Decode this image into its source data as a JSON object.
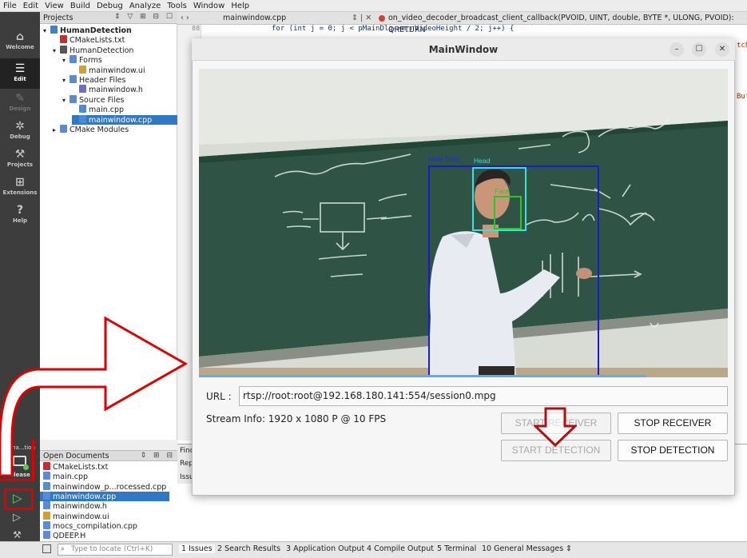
{
  "menu": [
    "File",
    "Edit",
    "View",
    "Build",
    "Debug",
    "Analyze",
    "Tools",
    "Window",
    "Help"
  ],
  "modes": [
    {
      "label": "Welcome",
      "icon": "⌂"
    },
    {
      "label": "Edit",
      "icon": "☰"
    },
    {
      "label": "Design",
      "icon": "✎"
    },
    {
      "label": "Debug",
      "icon": "✲"
    },
    {
      "label": "Projects",
      "icon": "⚒"
    },
    {
      "label": "Extensions",
      "icon": "⊞"
    },
    {
      "label": "Help",
      "icon": "?"
    }
  ],
  "kit": {
    "name": "Huma...tion",
    "config": "Release"
  },
  "projects": {
    "header": "Projects",
    "tree": [
      {
        "label": "HumanDetection",
        "depth": 0,
        "kind": "project"
      },
      {
        "label": "CMakeLists.txt",
        "depth": 1,
        "kind": "cmake"
      },
      {
        "label": "HumanDetection",
        "depth": 1,
        "kind": "target"
      },
      {
        "label": "Forms",
        "depth": 2,
        "kind": "folder"
      },
      {
        "label": "mainwindow.ui",
        "depth": 3,
        "kind": "ui"
      },
      {
        "label": "Header Files",
        "depth": 2,
        "kind": "folder"
      },
      {
        "label": "mainwindow.h",
        "depth": 3,
        "kind": "h"
      },
      {
        "label": "Source Files",
        "depth": 2,
        "kind": "folder"
      },
      {
        "label": "main.cpp",
        "depth": 3,
        "kind": "cpp"
      },
      {
        "label": "mainwindow.cpp",
        "depth": 3,
        "kind": "cpp",
        "selected": true
      },
      {
        "label": "CMake Modules",
        "depth": 1,
        "kind": "folder"
      }
    ]
  },
  "open_documents": {
    "header": "Open Documents",
    "items": [
      "CMakeLists.txt",
      "main.cpp",
      "mainwindow_p...rocessed.cpp",
      "mainwindow.cpp",
      "mainwindow.h",
      "mainwindow.ui",
      "mocs_compilation.cpp",
      "QDEEP.H"
    ],
    "selected_index": 3
  },
  "editor": {
    "file_tab": "mainwindow.cpp",
    "function_tab": "on_video_decoder_broadcast_client_callback(PVOID, UINT, double, BYTE *, ULONG, PVOID): QRETURN",
    "code_line": "for (int j = 0; j < pMainDlg->m_nVideoHeight / 2; j++) {",
    "line_no": "88",
    "side_text_1": "tch",
    "side_text_2": "Buf"
  },
  "find_area": {
    "l1": "Find",
    "l2": "Rep",
    "l3": "Issu"
  },
  "locator_placeholder": "Type to locate (Ctrl+K)",
  "output_tabs": [
    "1 Issues",
    "2 Search Results",
    "3 Application Output",
    "4 Compile Output",
    "5 Terminal",
    "10 General Messages"
  ],
  "main_window": {
    "title": "MainWindow",
    "video_labels": {
      "body": "Male Body",
      "head": "Head",
      "face": "Face"
    },
    "url_label": "URL :",
    "url_value": "rtsp://root:root@192.168.180.141:554/session0.mpg",
    "stream_info": "Stream Info: 1920 x 1080 P  @ 10 FPS",
    "buttons": {
      "start_receiver": "START RECEIVER",
      "stop_receiver": "STOP RECEIVER",
      "start_detection": "START DETECTION",
      "stop_detection": "STOP DETECTION"
    }
  },
  "colors": {
    "annotation_red": "#e00000",
    "selection_blue": "#2f78c8",
    "body_box": "#1a1acc",
    "head_box": "#38e0e0",
    "face_box": "#20cc20"
  }
}
